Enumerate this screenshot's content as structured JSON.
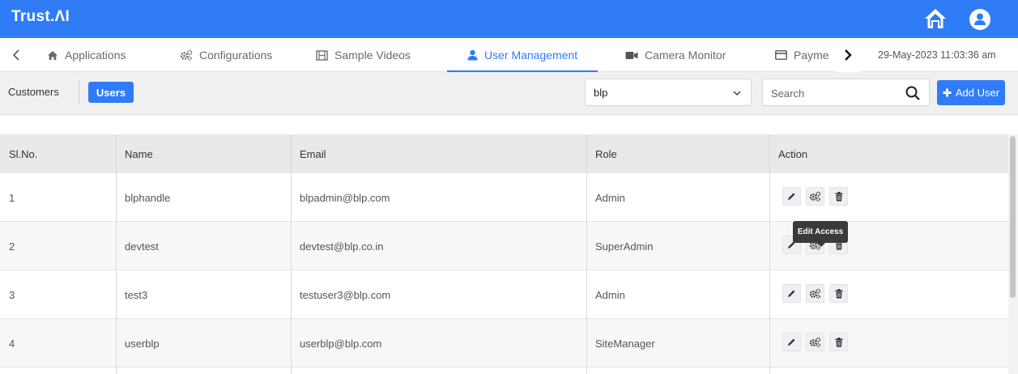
{
  "app": {
    "brand": "Trust.ΛI",
    "accent_color": "#2f7cf6",
    "icons": {
      "home": "home-icon",
      "user": "user-avatar-icon"
    }
  },
  "tabs": [
    {
      "label": "Applications",
      "icon": "home-icon",
      "active": false
    },
    {
      "label": "Configurations",
      "icon": "gears-icon",
      "active": false
    },
    {
      "label": "Sample Videos",
      "icon": "film-icon",
      "active": false
    },
    {
      "label": "User Management",
      "icon": "user-icon",
      "active": true
    },
    {
      "label": "Camera Monitor",
      "icon": "video-camera-icon",
      "active": false
    },
    {
      "label": "Payme",
      "icon": "credit-card-icon",
      "active": false
    }
  ],
  "datetime": "29-May-2023 11:03:36 am",
  "toolbar": {
    "customers_label": "Customers",
    "users_label": "Users",
    "customer_select_value": "blp",
    "search_placeholder": "Search",
    "add_user_label": "Add User"
  },
  "table": {
    "columns": [
      "Sl.No.",
      "Name",
      "Email",
      "Role",
      "Action"
    ],
    "rows": [
      {
        "sl": "1",
        "name": "blphandle",
        "email": "blpadmin@blp.com",
        "role": "Admin"
      },
      {
        "sl": "2",
        "name": "devtest",
        "email": "devtest@blp.co.in",
        "role": "SuperAdmin"
      },
      {
        "sl": "3",
        "name": "test3",
        "email": "testuser3@blp.com",
        "role": "Admin"
      },
      {
        "sl": "4",
        "name": "userblp",
        "email": "userblp@blp.com",
        "role": "SiteManager"
      }
    ],
    "action_icons": [
      "edit-pencil-icon",
      "access-gears-icon",
      "delete-trash-icon"
    ]
  },
  "tooltip": {
    "text": "Edit Access"
  }
}
